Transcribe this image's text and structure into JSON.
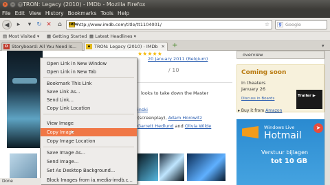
{
  "window": {
    "title": "TRON: Legacy (2010) - IMDb - Mozilla Firefox"
  },
  "menubar": {
    "items": [
      "File",
      "Edit",
      "View",
      "History",
      "Bookmarks",
      "Tools",
      "Help"
    ]
  },
  "nav": {
    "url": "http://www.imdb.com/title/tt1104001/",
    "search_placeholder": "Google",
    "fav_text": "IMDb"
  },
  "bookmarks": {
    "items": [
      "Most Visited",
      "Getting Started",
      "Latest Headlines"
    ]
  },
  "tabs": [
    {
      "label": "Storyboard: All You Need Is...",
      "active": false
    },
    {
      "label": "TRON: Legacy (2010) - IMDb",
      "active": true
    }
  ],
  "page": {
    "release_date": "20 January 2011 (Belgium)",
    "score_suffix": "10",
    "line1": "looks to take down the Master",
    "line_link1": "inski",
    "line_writers_prefix": "(screenplay), ",
    "line_writers_link": "Adam Horowitz",
    "line_stars_prefix": "",
    "line_stars_link1": "Garrett Hedlund",
    "line_stars_and": " and ",
    "line_stars_link2": "Olivia Wilde",
    "line_writers_sep": " and "
  },
  "sidebar": {
    "overview": "overview",
    "coming_title": "Coming soon",
    "coming_line1": "In theaters",
    "coming_line2": "January 26",
    "coming_discuss": "Discuss in Boards",
    "trailer": "Trailer",
    "buy_prefix": "Buy it from ",
    "buy_link": "Amazon",
    "ad_brand": "Windows Live",
    "ad_product": "Hotmail",
    "ad_line1": "Verstuur bijlagen",
    "ad_line2": "tot 10 GB"
  },
  "context_menu": {
    "items": [
      "Open Link in New Window",
      "Open Link in New Tab",
      "Bookmark This Link",
      "Save Link As...",
      "Send Link...",
      "Copy Link Location",
      "View Image",
      "Copy Image",
      "Copy Image Location",
      "Save Image As...",
      "Send Image...",
      "Set As Desktop Background...",
      "Block Images from ia.media-imdb.c..."
    ],
    "highlighted": "Copy Image"
  },
  "status": {
    "text": "Done"
  },
  "colors": {
    "menu_highlight": "#f07746",
    "titlebar": "#3c3b37",
    "link": "#2a5db0"
  }
}
